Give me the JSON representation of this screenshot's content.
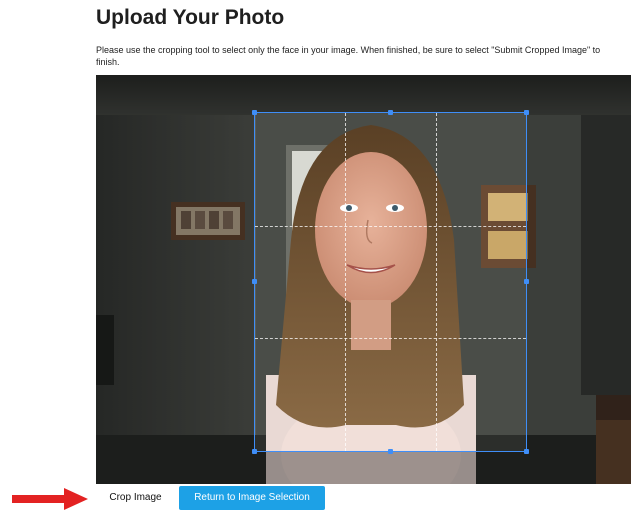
{
  "header": {
    "title": "Upload Your Photo",
    "instructions": "Please use the cropping tool to select only the face in your image. When finished, be sure to select \"Submit Cropped Image\" to finish."
  },
  "cropper": {
    "image_icon": "photo-of-woman",
    "selection_color": "#3f8ef7"
  },
  "actions": {
    "crop_label": "Crop Image",
    "return_label": "Return to Image Selection",
    "accent_color": "#1da1e6",
    "pointer_icon": "red-arrow-right-icon",
    "pointer_color": "#e32222"
  }
}
